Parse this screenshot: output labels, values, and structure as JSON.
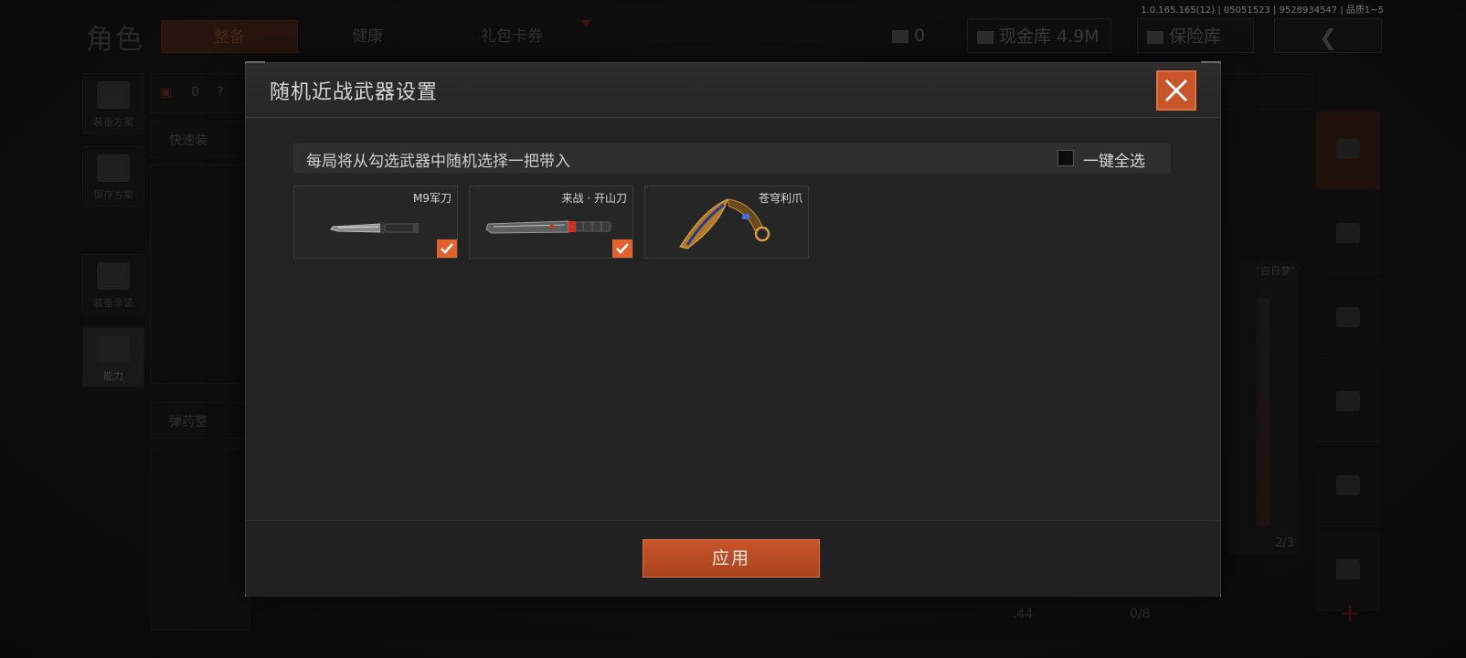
{
  "version": "1.0.165.165(12) | 05051523 | 9528934547 | 品质1~5",
  "header": {
    "page_title": "角色",
    "tabs": [
      {
        "label": "整备",
        "active": true
      },
      {
        "label": "健康",
        "active": false
      },
      {
        "label": "礼包卡券",
        "active": false
      }
    ],
    "ticket_count": "0",
    "cash_label": "现金库 4.9M",
    "vault_label": "保险库"
  },
  "sidebar": {
    "items": [
      {
        "label": "装备方案"
      },
      {
        "label": "保存方案"
      },
      {
        "label": "装备涂装"
      },
      {
        "label": "能力"
      }
    ]
  },
  "background": {
    "quick_equip": "快速装",
    "ammo": "弹药整",
    "backpack_count": "0",
    "help": "?",
    "gun_tag": "“白日梦”",
    "gun_count": "2/3",
    "ammo_caliber": ".44",
    "ammo_count": "0/8"
  },
  "modal": {
    "title": "随机近战武器设置",
    "info_text": "每局将从勾选武器中随机选择一把带入",
    "select_all_label": "一键全选",
    "apply_label": "应用",
    "weapons": [
      {
        "name": "M9军刀",
        "checked": true,
        "icon": "combat-knife-icon"
      },
      {
        "name": "来战 · 开山刀",
        "checked": true,
        "icon": "machete-icon"
      },
      {
        "name": "苍穹利爪",
        "checked": false,
        "icon": "karambit-icon"
      }
    ]
  },
  "colors": {
    "accent": "#e0622e",
    "panel": "#232323"
  }
}
